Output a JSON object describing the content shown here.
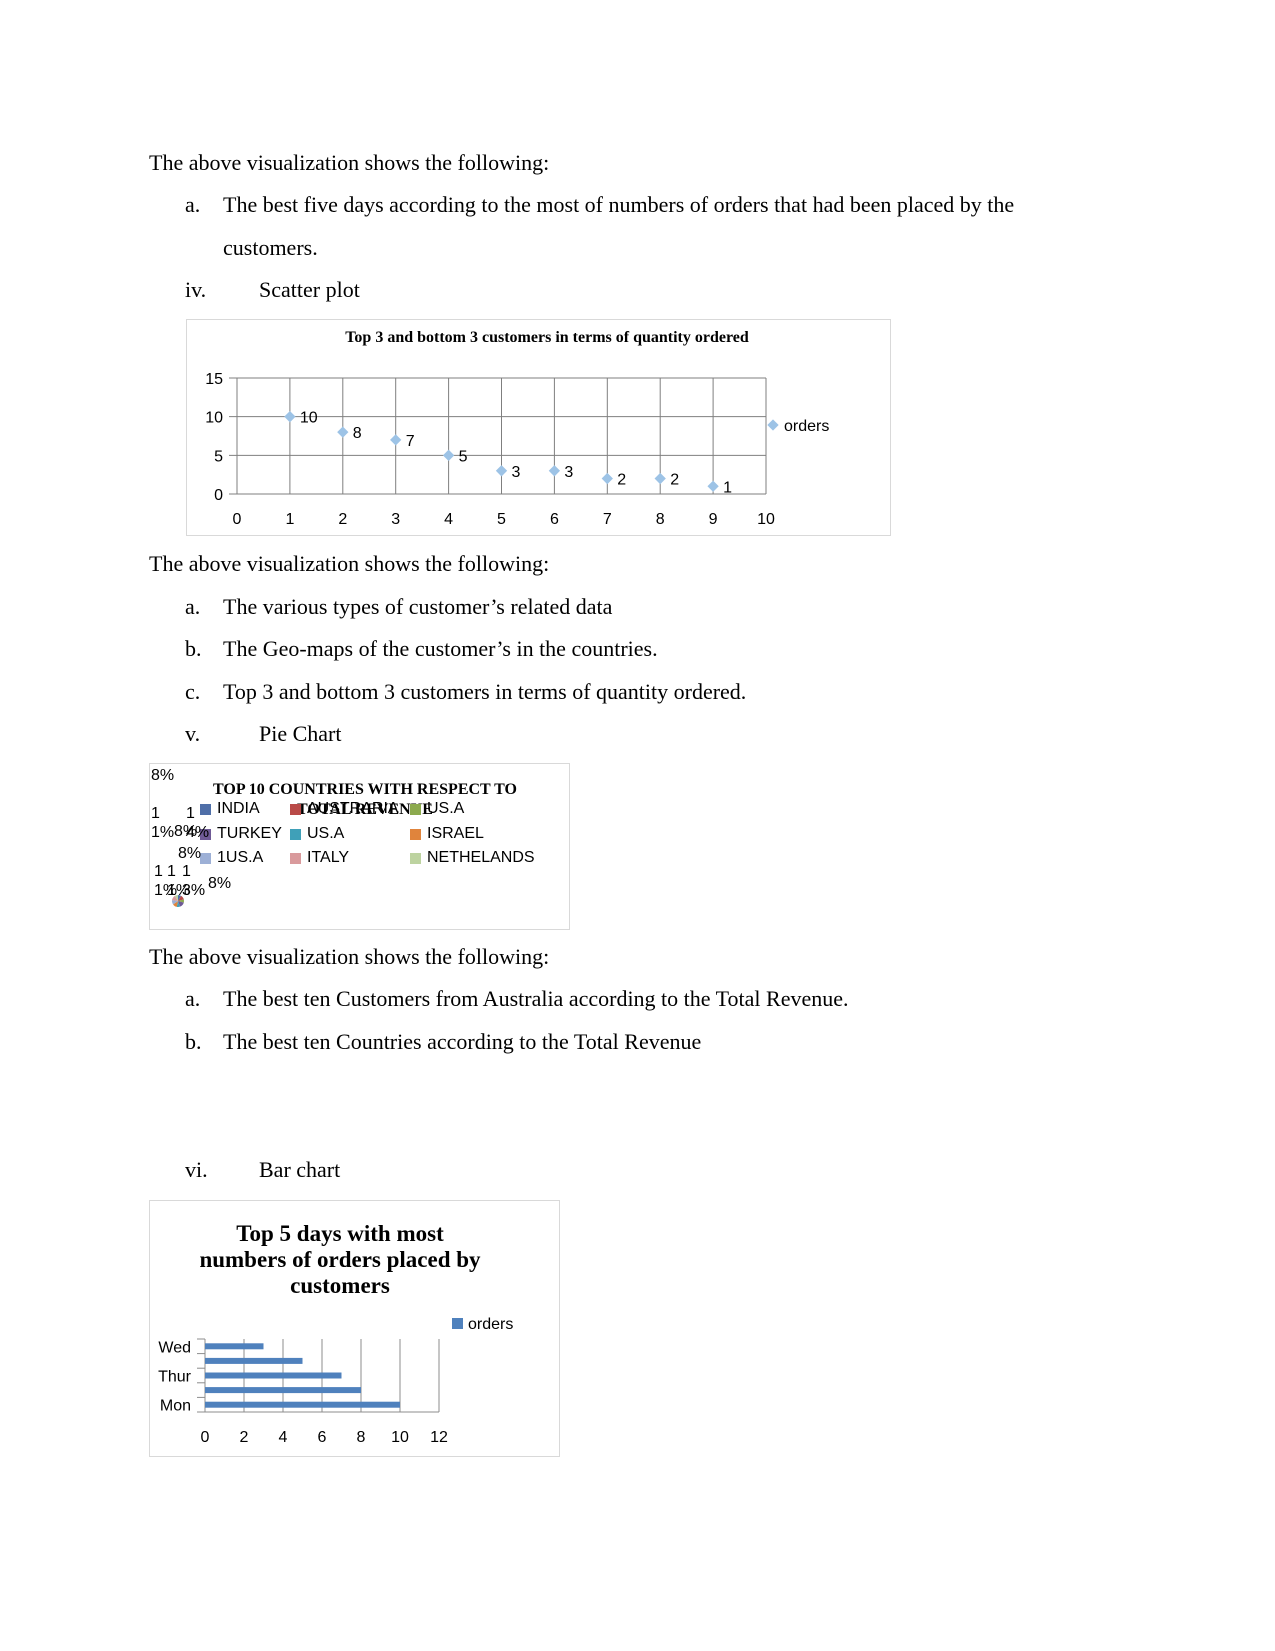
{
  "paragraphs": {
    "intro1": "The above visualization shows the following:",
    "list1": [
      {
        "marker": "a.",
        "text": "The best five days according to the most of numbers of orders that had been placed by the",
        "cont": "customers."
      }
    ],
    "heading_iv": {
      "marker": "iv.",
      "text": "Scatter plot"
    },
    "intro2": "The above visualization shows the following:",
    "list2": [
      {
        "marker": "a.",
        "text": "The various types of customer’s related data"
      },
      {
        "marker": "b.",
        "text": "The Geo-maps of the customer’s in the countries."
      },
      {
        "marker": "c.",
        "text": "Top 3 and bottom 3 customers in terms of quantity ordered."
      }
    ],
    "heading_v": {
      "marker": "v.",
      "text": "Pie Chart"
    },
    "intro3": "The above visualization shows the following:",
    "list3": [
      {
        "marker": "a.",
        "text": "The best ten Customers from Australia according to the Total Revenue."
      },
      {
        "marker": "b.",
        "text": "The best ten Countries according to the Total Revenue"
      }
    ],
    "heading_vi": {
      "marker": "vi.",
      "text": "Bar chart"
    }
  },
  "chart_data": [
    {
      "type": "scatter",
      "title": "Top 3 and bottom 3 customers in terms of quantity ordered",
      "x": [
        1,
        2,
        3,
        4,
        5,
        6,
        7,
        8,
        9
      ],
      "series": [
        {
          "name": "orders",
          "values": [
            10,
            8,
            7,
            5,
            3,
            3,
            2,
            2,
            1
          ]
        }
      ],
      "data_labels": [
        "10",
        "8",
        "7",
        "5",
        "3",
        "3",
        "2",
        "2",
        "1"
      ],
      "xlim": [
        0,
        10
      ],
      "ylim": [
        0,
        15
      ],
      "xticks": [
        "0",
        "1",
        "2",
        "3",
        "4",
        "5",
        "6",
        "7",
        "8",
        "9",
        "10"
      ],
      "yticks": [
        "0",
        "5",
        "10",
        "15"
      ],
      "grid": true,
      "legend": "right",
      "color": "#9dc3e6"
    },
    {
      "type": "pie",
      "title": "TOP 10 COUNTRIES WITH RESPECT TO TOTAL REVENUE",
      "categories": [
        "INDIA",
        "AUSTRARIA",
        "US.A",
        "TURKEY",
        "US.A",
        "ISRAEL",
        "1US.A",
        "ITALY",
        "NETHELANDS"
      ],
      "colors": [
        "#4f6fa8",
        "#b94a48",
        "#8caa4e",
        "#6f5a96",
        "#3fa0b8",
        "#e0843c",
        "#9db0d6",
        "#d99a9c",
        "#bdd3a0"
      ],
      "data_labels": [
        "8%",
        "11%",
        "8%",
        "14%",
        "8%",
        "11%",
        "11%",
        "13%",
        "8%"
      ],
      "values": [
        8,
        11,
        8,
        14,
        8,
        11,
        11,
        13,
        8
      ],
      "legend": "top"
    },
    {
      "type": "bar",
      "orientation": "horizontal",
      "title": "Top 5 days with most numbers of orders placed by customers",
      "categories": [
        "Mon",
        "",
        "Thur",
        "",
        "Wed"
      ],
      "series": [
        {
          "name": "orders",
          "values": [
            10,
            8,
            7,
            5,
            3
          ]
        }
      ],
      "xlim": [
        0,
        12
      ],
      "xticks": [
        "0",
        "2",
        "4",
        "6",
        "8",
        "10",
        "12"
      ],
      "grid": true,
      "legend": "top-right",
      "color": "#4f81bd"
    }
  ]
}
